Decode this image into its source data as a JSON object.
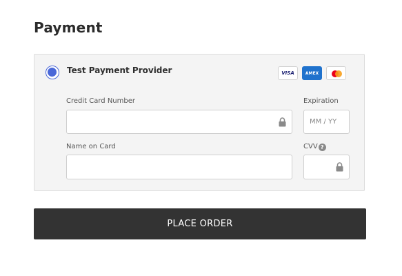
{
  "section": {
    "title": "Payment"
  },
  "payment_method": {
    "name": "Test Payment Provider",
    "selected": true,
    "accepted_cards": [
      {
        "label": "VISA",
        "icon": "visa-icon"
      },
      {
        "label": "AMEX",
        "icon": "amex-icon"
      },
      {
        "label": "",
        "icon": "mastercard-icon"
      }
    ]
  },
  "form": {
    "card_number_label": "Credit Card Number",
    "card_number_value": "",
    "expiration_label": "Expiration",
    "expiration_placeholder": "MM / YY",
    "name_label": "Name on Card",
    "name_value": "",
    "cvv_label": "CVV",
    "cvv_value": ""
  },
  "actions": {
    "place_order_label": "PLACE ORDER"
  },
  "colors": {
    "accent": "#4a68d8",
    "button_bg": "#333333",
    "panel_bg": "#f4f4f4"
  }
}
